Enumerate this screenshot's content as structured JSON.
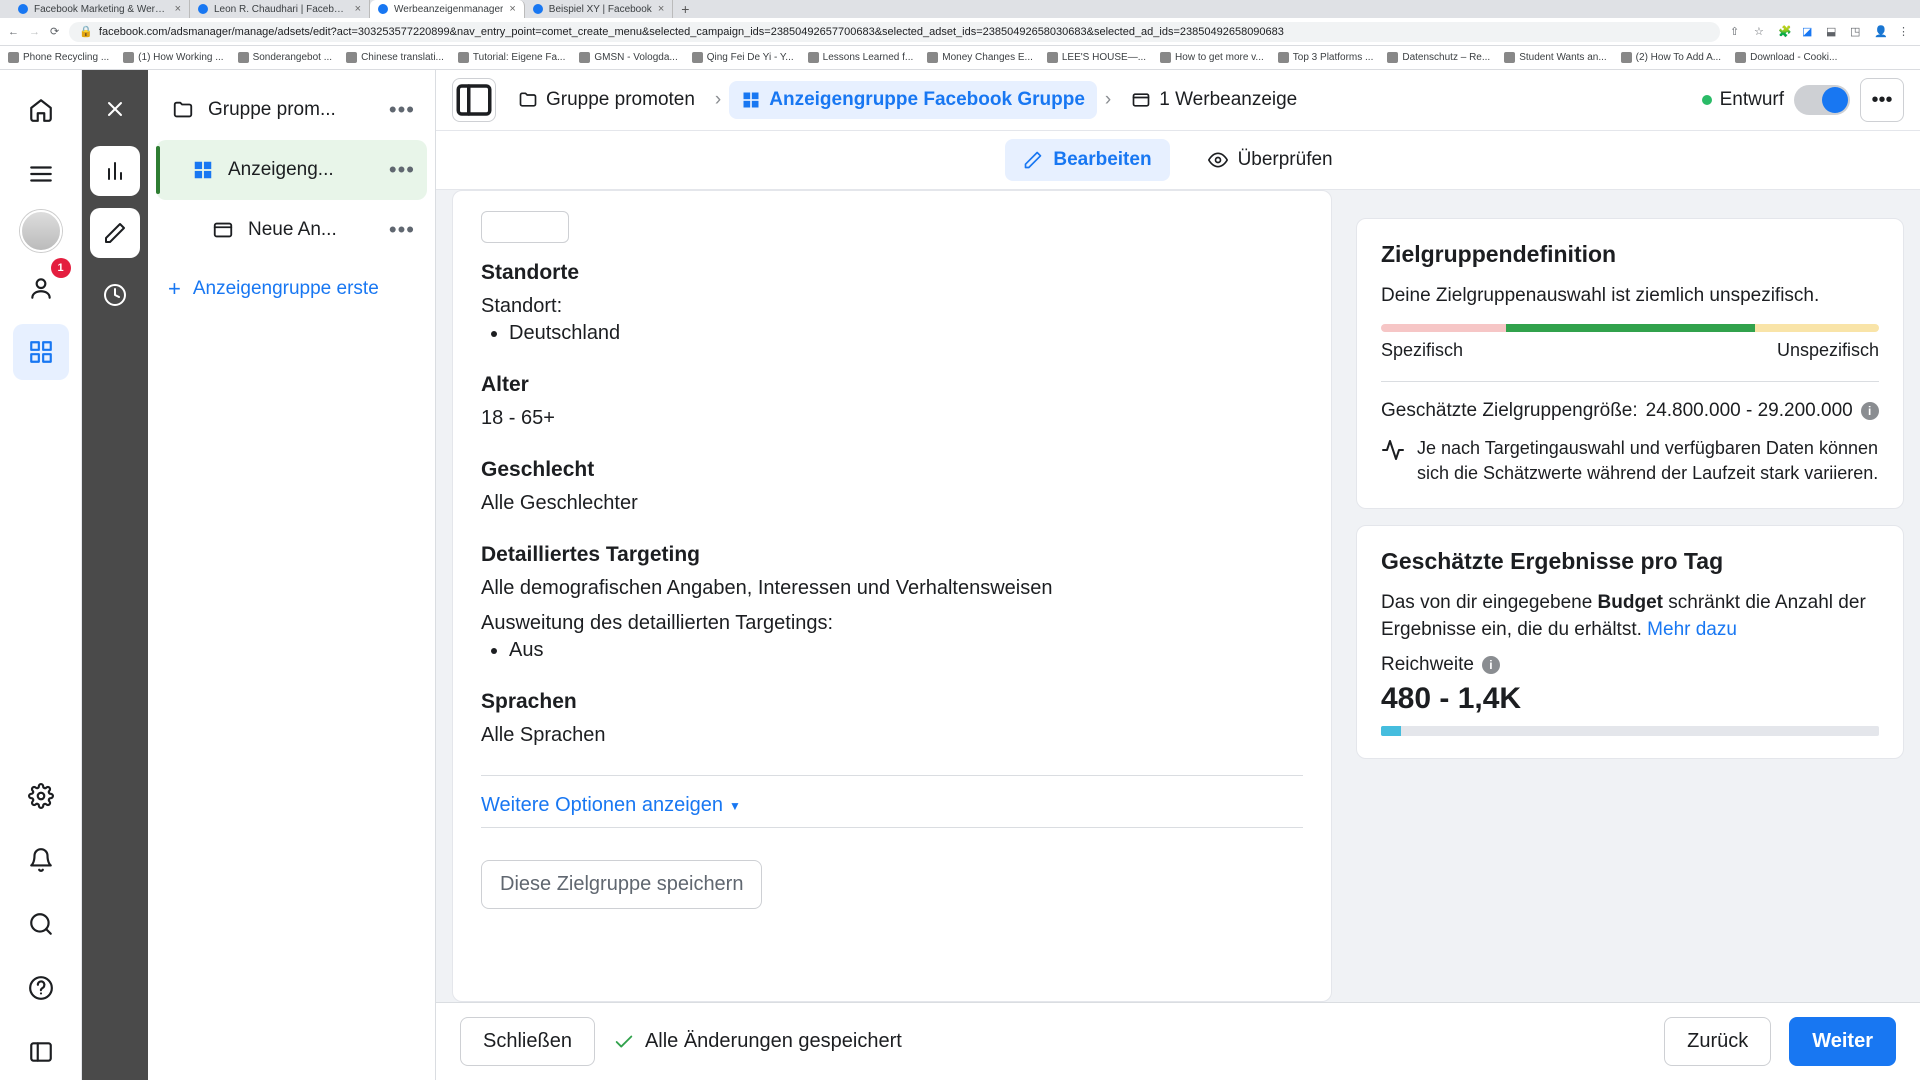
{
  "browser": {
    "tabs": [
      {
        "title": "Facebook Marketing & Werbe..."
      },
      {
        "title": "Leon R. Chaudhari | Facebook"
      },
      {
        "title": "Werbeanzeigenmanager",
        "active": true
      },
      {
        "title": "Beispiel XY | Facebook"
      }
    ],
    "url": "facebook.com/adsmanager/manage/adsets/edit?act=303253577220899&nav_entry_point=comet_create_menu&selected_campaign_ids=23850492657700683&selected_adset_ids=23850492658030683&selected_ad_ids=23850492658090683",
    "bookmarks": [
      "Phone Recycling ...",
      "(1) How Working ...",
      "Sonderangebot ...",
      "Chinese translati...",
      "Tutorial: Eigene Fa...",
      "GMSN - Vologda...",
      "Qing Fei De Yi - Y...",
      "Lessons Learned f...",
      "Money Changes E...",
      "LEE'S HOUSE—...",
      "How to get more v...",
      "Top 3 Platforms ...",
      "Datenschutz – Re...",
      "Student Wants an...",
      "(2) How To Add A...",
      "Download - Cooki..."
    ]
  },
  "rail": {
    "badge": "1"
  },
  "tree": {
    "items": [
      {
        "label": "Gruppe prom...",
        "level": 0,
        "icon": "folder"
      },
      {
        "label": "Anzeigeng...",
        "level": 1,
        "icon": "grid",
        "selected": true
      },
      {
        "label": "Neue An...",
        "level": 2,
        "icon": "ad"
      }
    ],
    "add_label": "Anzeigengruppe erste"
  },
  "breadcrumb": {
    "items": [
      {
        "label": "Gruppe promoten",
        "icon": "folder"
      },
      {
        "label": "Anzeigengruppe Facebook Gruppe",
        "icon": "grid",
        "active": true
      },
      {
        "label": "1 Werbeanzeige",
        "icon": "ad"
      }
    ],
    "status": "Entwurf"
  },
  "tabs": {
    "edit": "Bearbeiten",
    "review": "Überprüfen"
  },
  "targeting": {
    "locations_h": "Standorte",
    "location_label": "Standort:",
    "location_items": [
      "Deutschland"
    ],
    "age_h": "Alter",
    "age_val": "18 - 65+",
    "gender_h": "Geschlecht",
    "gender_val": "Alle Geschlechter",
    "detailed_h": "Detailliertes Targeting",
    "detailed_val": "Alle demografischen Angaben, Interessen und Verhaltensweisen",
    "expansion_label": "Ausweitung des detaillierten Targetings:",
    "expansion_items": [
      "Aus"
    ],
    "lang_h": "Sprachen",
    "lang_val": "Alle Sprachen",
    "more_options": "Weitere Optionen anzeigen",
    "save_audience": "Diese Zielgruppe speichern"
  },
  "audience_def": {
    "title": "Zielgruppendefinition",
    "subtitle": "Deine Zielgruppenauswahl ist ziemlich unspezifisch.",
    "label_specific": "Spezifisch",
    "label_unspecific": "Unspezifisch",
    "est_label": "Geschätzte Zielgruppengröße:",
    "est_val": "24.800.000 - 29.200.000",
    "note": "Je nach Targetingauswahl und verfügbaren Daten können sich die Schätzwerte während der Laufzeit stark variieren."
  },
  "daily": {
    "title": "Geschätzte Ergebnisse pro Tag",
    "body_1": "Das von dir eingegebene ",
    "body_bold": "Budget",
    "body_2": " schränkt die Anzahl der Ergebnisse ein, die du erhältst. ",
    "learn_more": "Mehr dazu",
    "reach_label": "Reichweite",
    "reach_val": "480 - 1,4K"
  },
  "footer": {
    "close": "Schließen",
    "saved": "Alle Änderungen gespeichert",
    "back": "Zurück",
    "next": "Weiter"
  }
}
